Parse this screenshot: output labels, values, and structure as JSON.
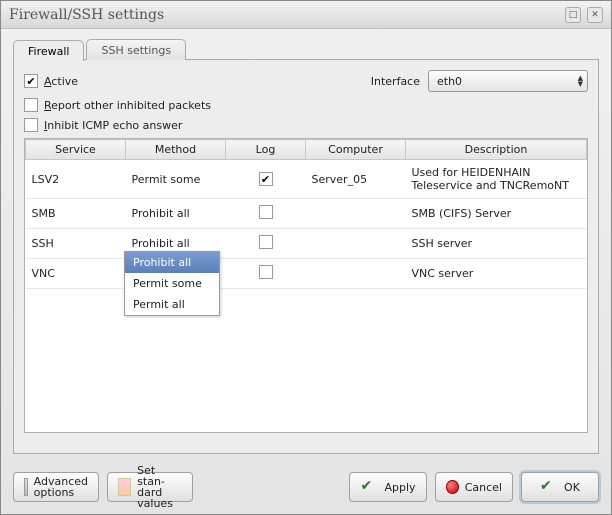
{
  "window": {
    "title": "Firewall/SSH settings"
  },
  "tabs": {
    "firewall": "Firewall",
    "ssh": "SSH settings"
  },
  "options": {
    "active_prefix": "A",
    "active_rest": "ctive",
    "report_prefix": "R",
    "report_rest": "eport other inhibited packets",
    "inhibit_prefix": "I",
    "inhibit_rest": "nhibit ICMP echo answer",
    "iface_label": "Interface",
    "iface_value": "eth0"
  },
  "table": {
    "headers": {
      "service": "Service",
      "method": "Method",
      "log": "Log",
      "computer": "Computer",
      "description": "Description"
    },
    "rows": [
      {
        "service": "LSV2",
        "method": "Permit some",
        "log": true,
        "computer": "Server_05",
        "desc": "Used for HEIDENHAIN Teleservice and TNCRemoNT"
      },
      {
        "service": "SMB",
        "method": "Prohibit all",
        "log": false,
        "computer": "",
        "desc": "SMB (CIFS) Server"
      },
      {
        "service": "SSH",
        "method": "Prohibit all",
        "log": false,
        "computer": "",
        "desc": "SSH server"
      },
      {
        "service": "VNC",
        "method": "",
        "log": false,
        "computer": "",
        "desc": "VNC server"
      }
    ]
  },
  "dropdown": {
    "items": [
      "Prohibit all",
      "Permit some",
      "Permit all"
    ],
    "selected": "Prohibit all"
  },
  "buttons": {
    "advanced_l1": "Advanced",
    "advanced_l2": "options",
    "standard_l1": "Set stan-",
    "standard_l2": "dard values",
    "apply": "Apply",
    "cancel_prefix": "C",
    "cancel_rest": "ancel",
    "ok_prefix": "O",
    "ok_rest": "K"
  }
}
